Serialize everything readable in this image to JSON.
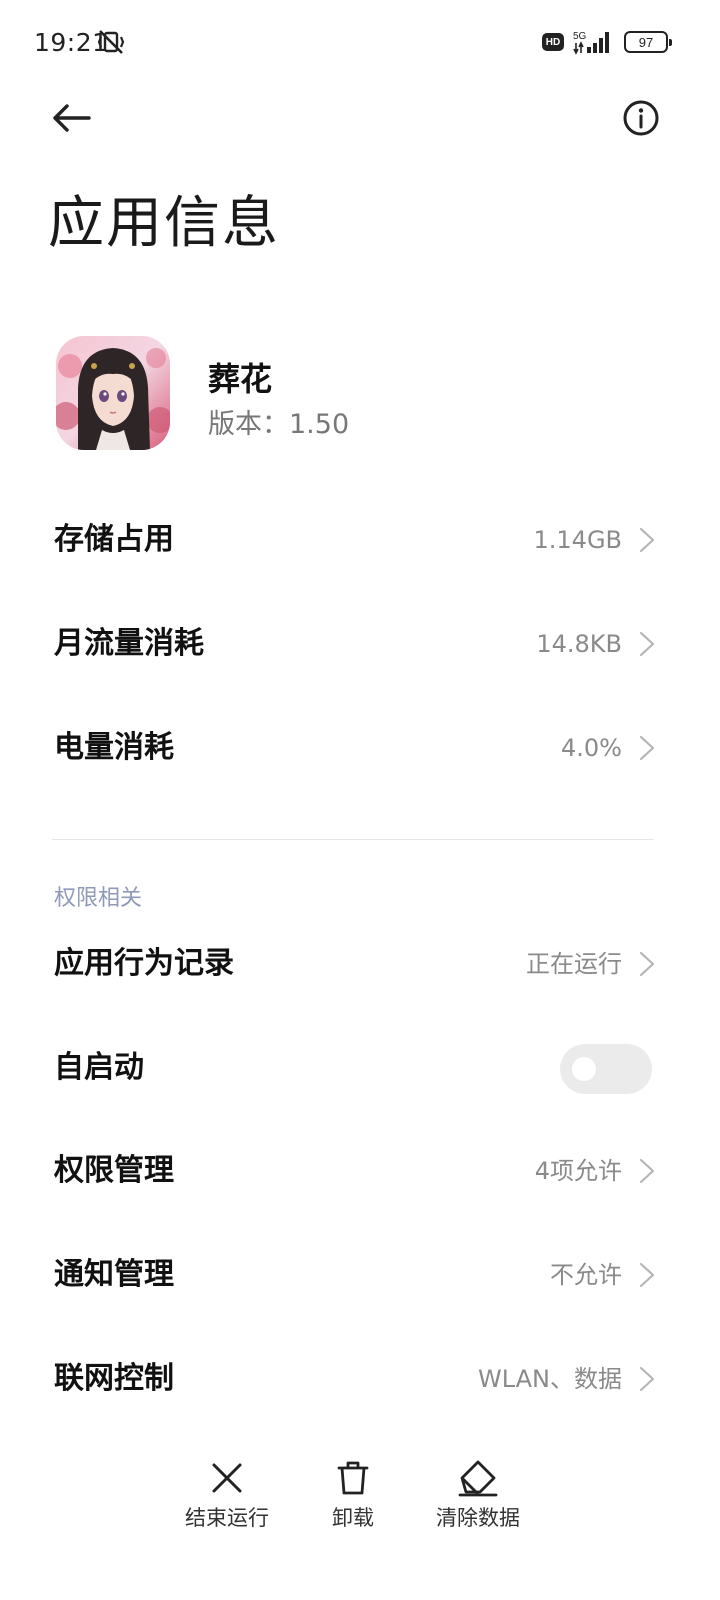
{
  "status_bar": {
    "time": "19:21",
    "network": "5G",
    "hd": "HD",
    "battery": "97"
  },
  "header": {
    "back_icon": "arrow-left-icon",
    "info_icon": "info-circle-icon",
    "title": "应用信息"
  },
  "app": {
    "name": "葬花",
    "version": "版本：1.50"
  },
  "usage_rows": [
    {
      "label": "存储占用",
      "value": "1.14GB"
    },
    {
      "label": "月流量消耗",
      "value": "14.8KB"
    },
    {
      "label": "电量消耗",
      "value": "4.0%"
    }
  ],
  "permissions": {
    "section_label": "权限相关",
    "behavior_record": {
      "label": "应用行为记录",
      "value": "正在运行"
    },
    "auto_start": {
      "label": "自启动",
      "enabled": false
    },
    "permission_manage": {
      "label": "权限管理",
      "value": "4项允许"
    },
    "notification_manage": {
      "label": "通知管理",
      "value": "不允许"
    },
    "network_control": {
      "label": "联网控制",
      "value": "WLAN、数据"
    }
  },
  "actions": [
    {
      "label": "结束运行",
      "icon": "close-x-icon"
    },
    {
      "label": "卸载",
      "icon": "trash-icon"
    },
    {
      "label": "清除数据",
      "icon": "eraser-icon"
    }
  ],
  "colors": {
    "section_label": "#8e9ab8",
    "value_text": "#8a8a8a",
    "toggle_off": "#ebebeb"
  }
}
